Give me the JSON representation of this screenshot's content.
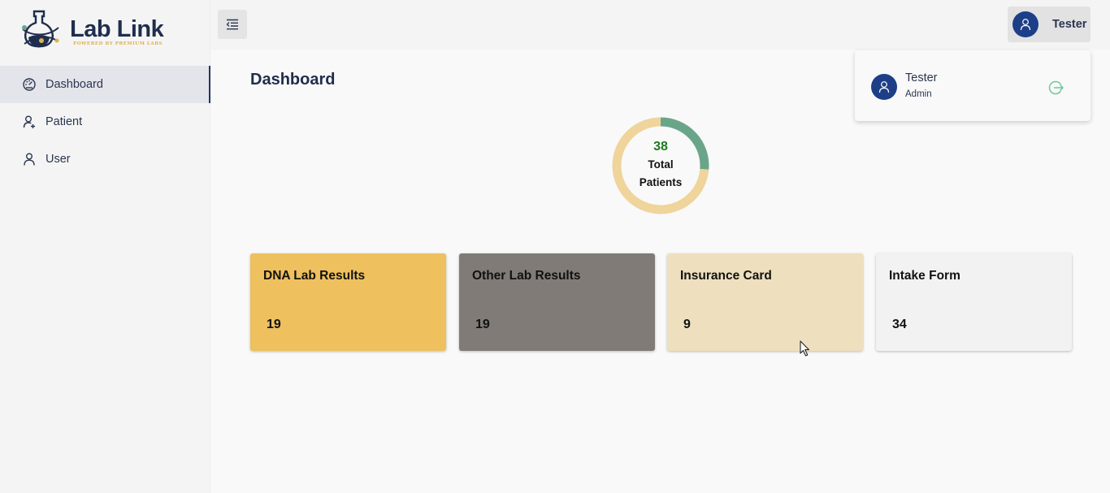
{
  "brand": {
    "name": "Lab Link",
    "tagline": "POWERED BY PREMIUM LABS"
  },
  "sidebar": {
    "items": [
      {
        "label": "Dashboard",
        "icon": "dashboard-gauge-icon",
        "active": true
      },
      {
        "label": "Patient",
        "icon": "user-plus-icon",
        "active": false
      },
      {
        "label": "User",
        "icon": "user-icon",
        "active": false
      }
    ]
  },
  "header": {
    "menu_icon": "menu-indent-icon",
    "user": {
      "name": "Tester",
      "icon": "user-avatar-icon"
    }
  },
  "user_dropdown": {
    "name": "Tester",
    "role": "Admin",
    "logout_icon": "logout-icon"
  },
  "main": {
    "title": "Dashboard",
    "summary": {
      "total": "38",
      "label_line1": "Total",
      "label_line2": "Patients"
    },
    "cards": [
      {
        "title": "DNA Lab Results",
        "value": "19",
        "color": "#eec05e"
      },
      {
        "title": "Other Lab Results",
        "value": "19",
        "color": "#807b76"
      },
      {
        "title": "Insurance Card",
        "value": "9",
        "color": "#eedfbe"
      },
      {
        "title": "Intake Form",
        "value": "34",
        "color": "#f2f2f2"
      }
    ]
  },
  "chart_data": {
    "type": "pie",
    "categories": [
      "",
      ""
    ],
    "values": [
      10,
      28
    ],
    "colors": [
      "#6aa58a",
      "#efd49b"
    ],
    "center_value": "38",
    "center_label": "Total Patients"
  },
  "colors": {
    "accent": "#24345e",
    "avatar": "#1d3f87",
    "logout": "#6cc79a"
  }
}
